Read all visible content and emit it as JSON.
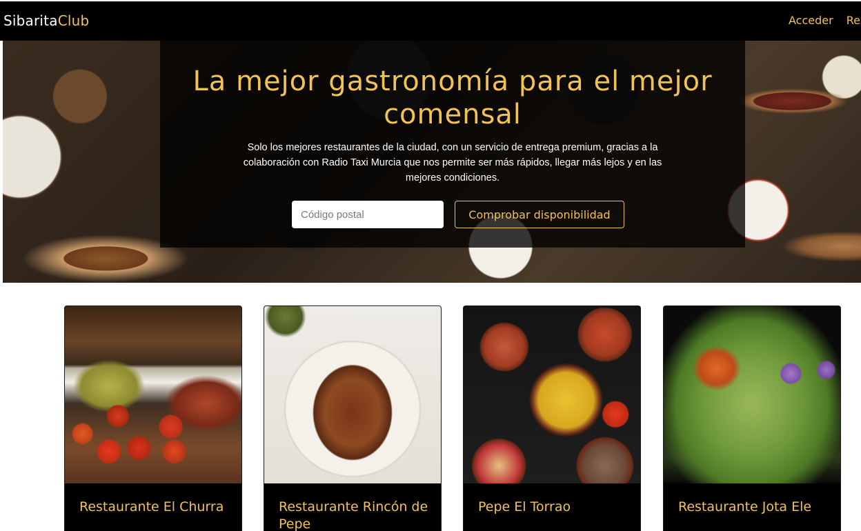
{
  "navbar": {
    "brand_primary": "Sibarita",
    "brand_accent": "Club",
    "links": [
      "Acceder",
      "Re"
    ]
  },
  "hero": {
    "title": "La mejor gastronomía para el mejor comensal",
    "description": "Solo los mejores restaurantes de la ciudad, con un servicio de entrega premium, gracias a la colaboración con Radio Taxi Murcia que nos permite ser más rápidos, llegar más lejos y en las mejores condiciones.",
    "postal_placeholder": "Código postal",
    "postal_value": "",
    "check_button": "Comprobar disponibilidad"
  },
  "restaurants": [
    {
      "name": "Restaurante El Churra"
    },
    {
      "name": "Restaurante Rincón de Pepe"
    },
    {
      "name": "Pepe El Torrao"
    },
    {
      "name": "Restaurante Jota Ele"
    }
  ],
  "colors": {
    "accent": "#f1c15a",
    "navbar_bg": "#000000",
    "card_body_bg": "#000000"
  }
}
